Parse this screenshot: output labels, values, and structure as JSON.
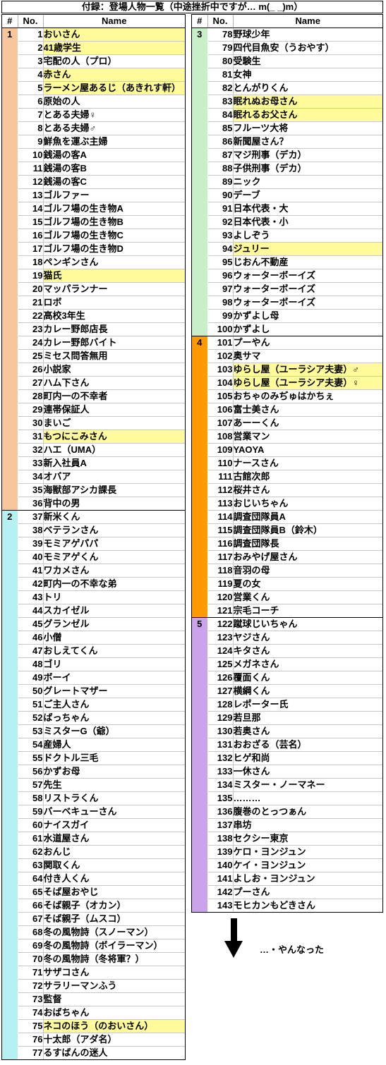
{
  "title": "付録：登場人物一覧（中途挫折中ですが… m(_ _)m）",
  "columns": {
    "group": "#",
    "no": "No.",
    "name": "Name"
  },
  "colors": {
    "group1": "#F7C79B",
    "group2": "#B5F0F2",
    "group3": "#C8F0C8",
    "group4": "#FF9900",
    "group5": "#CBA3EB",
    "highlight": "#FFFB9A",
    "grid_line": "#C8C8C8",
    "border": "#000000"
  },
  "footer": {
    "note": "…・やんなった",
    "arrow": "down-arrow"
  },
  "left_table": {
    "rows": [
      {
        "group": "1",
        "no": "1",
        "name": "おいさん",
        "hl": true
      },
      {
        "group": "",
        "no": "2",
        "name": "41歳学生",
        "hl": true
      },
      {
        "group": "",
        "no": "3",
        "name": "宅配の人（プロ）",
        "hl": false
      },
      {
        "group": "",
        "no": "4",
        "name": "赤さん",
        "hl": true
      },
      {
        "group": "",
        "no": "5",
        "name": "ラーメン屋あるじ（あきれす軒）",
        "hl": true
      },
      {
        "group": "",
        "no": "6",
        "name": "原始の人",
        "hl": false
      },
      {
        "group": "",
        "no": "7",
        "name": "とある夫婦♀",
        "hl": false
      },
      {
        "group": "",
        "no": "8",
        "name": "とある夫婦♂",
        "hl": false
      },
      {
        "group": "",
        "no": "9",
        "name": "鮮魚を運ぶ主婦",
        "hl": false
      },
      {
        "group": "",
        "no": "10",
        "name": "銭湯の客A",
        "hl": false
      },
      {
        "group": "",
        "no": "11",
        "name": "銭湯の客B",
        "hl": false
      },
      {
        "group": "",
        "no": "12",
        "name": "銭湯の客C",
        "hl": false
      },
      {
        "group": "",
        "no": "13",
        "name": "ゴルファー",
        "hl": false
      },
      {
        "group": "",
        "no": "14",
        "name": "ゴルフ場の生き物A",
        "hl": false
      },
      {
        "group": "",
        "no": "15",
        "name": "ゴルフ場の生き物B",
        "hl": false
      },
      {
        "group": "",
        "no": "16",
        "name": "ゴルフ場の生き物C",
        "hl": false
      },
      {
        "group": "",
        "no": "17",
        "name": "ゴルフ場の生き物D",
        "hl": false
      },
      {
        "group": "",
        "no": "18",
        "name": "ペンギンさん",
        "hl": false
      },
      {
        "group": "",
        "no": "19",
        "name": "猫氏",
        "hl": true
      },
      {
        "group": "",
        "no": "20",
        "name": "マッパランナー",
        "hl": false
      },
      {
        "group": "",
        "no": "21",
        "name": "ロボ",
        "hl": false
      },
      {
        "group": "",
        "no": "22",
        "name": "高校3年生",
        "hl": false
      },
      {
        "group": "",
        "no": "23",
        "name": "カレー野郎店長",
        "hl": false
      },
      {
        "group": "",
        "no": "24",
        "name": "カレー野郎バイト",
        "hl": false
      },
      {
        "group": "",
        "no": "25",
        "name": "ミセス問答無用",
        "hl": false
      },
      {
        "group": "",
        "no": "26",
        "name": "小説家",
        "hl": false
      },
      {
        "group": "",
        "no": "27",
        "name": "ハム下さん",
        "hl": false
      },
      {
        "group": "",
        "no": "28",
        "name": "町内一の不幸者",
        "hl": false
      },
      {
        "group": "",
        "no": "29",
        "name": "連帯保証人",
        "hl": false
      },
      {
        "group": "",
        "no": "30",
        "name": "まいご",
        "hl": false
      },
      {
        "group": "",
        "no": "31",
        "name": "もつにこみさん",
        "hl": true
      },
      {
        "group": "",
        "no": "32",
        "name": "ハエ（UMA）",
        "hl": false
      },
      {
        "group": "",
        "no": "33",
        "name": "新入社員A",
        "hl": false
      },
      {
        "group": "",
        "no": "34",
        "name": "オバア",
        "hl": false
      },
      {
        "group": "",
        "no": "35",
        "name": "海獣部アシカ課長",
        "hl": false
      },
      {
        "group": "",
        "no": "36",
        "name": "背中の男",
        "hl": false,
        "group_end": true
      },
      {
        "group": "2",
        "no": "37",
        "name": "新米くん",
        "hl": false
      },
      {
        "group": "",
        "no": "38",
        "name": "ベテランさん",
        "hl": false
      },
      {
        "group": "",
        "no": "39",
        "name": "モミアゲパパ",
        "hl": false
      },
      {
        "group": "",
        "no": "40",
        "name": "モミアゲくん",
        "hl": false
      },
      {
        "group": "",
        "no": "41",
        "name": "ワカメさん",
        "hl": false
      },
      {
        "group": "",
        "no": "42",
        "name": "町内一の不幸な弟",
        "hl": false
      },
      {
        "group": "",
        "no": "43",
        "name": "トリ",
        "hl": false
      },
      {
        "group": "",
        "no": "44",
        "name": "スカイゼル",
        "hl": false
      },
      {
        "group": "",
        "no": "45",
        "name": "グランゼル",
        "hl": false
      },
      {
        "group": "",
        "no": "46",
        "name": "小僧",
        "hl": false
      },
      {
        "group": "",
        "no": "47",
        "name": "おしえてくん",
        "hl": false
      },
      {
        "group": "",
        "no": "48",
        "name": "ゴリ",
        "hl": false
      },
      {
        "group": "",
        "no": "49",
        "name": "ボーイ",
        "hl": false
      },
      {
        "group": "",
        "no": "50",
        "name": "グレートマザー",
        "hl": false
      },
      {
        "group": "",
        "no": "51",
        "name": "ご主人さん",
        "hl": false
      },
      {
        "group": "",
        "no": "52",
        "name": "ばっちゃん",
        "hl": false
      },
      {
        "group": "",
        "no": "53",
        "name": "ミスターG（爺）",
        "hl": false
      },
      {
        "group": "",
        "no": "54",
        "name": "産婦人",
        "hl": false
      },
      {
        "group": "",
        "no": "55",
        "name": "ドクトル三毛",
        "hl": false
      },
      {
        "group": "",
        "no": "56",
        "name": "かずお母",
        "hl": false
      },
      {
        "group": "",
        "no": "57",
        "name": "先生",
        "hl": false
      },
      {
        "group": "",
        "no": "58",
        "name": "リストラくん",
        "hl": false
      },
      {
        "group": "",
        "no": "59",
        "name": "バーベキューさん",
        "hl": false
      },
      {
        "group": "",
        "no": "60",
        "name": "ナイスガイ",
        "hl": false
      },
      {
        "group": "",
        "no": "61",
        "name": "水道屋さん",
        "hl": false
      },
      {
        "group": "",
        "no": "62",
        "name": "おんじ",
        "hl": false
      },
      {
        "group": "",
        "no": "63",
        "name": "関取くん",
        "hl": false
      },
      {
        "group": "",
        "no": "64",
        "name": "付き人くん",
        "hl": false
      },
      {
        "group": "",
        "no": "65",
        "name": "そば屋おやじ",
        "hl": false
      },
      {
        "group": "",
        "no": "66",
        "name": "そば親子（オカン）",
        "hl": false
      },
      {
        "group": "",
        "no": "67",
        "name": "そば親子（ムスコ）",
        "hl": false
      },
      {
        "group": "",
        "no": "68",
        "name": "冬の風物詩（スノーマン）",
        "hl": false
      },
      {
        "group": "",
        "no": "69",
        "name": "冬の風物詩（ボイラーマン）",
        "hl": false
      },
      {
        "group": "",
        "no": "70",
        "name": "冬の風物詩（冬将軍？）",
        "hl": false
      },
      {
        "group": "",
        "no": "71",
        "name": "サザコさん",
        "hl": false
      },
      {
        "group": "",
        "no": "72",
        "name": "サラリーマンふう",
        "hl": false
      },
      {
        "group": "",
        "no": "73",
        "name": "監督",
        "hl": false
      },
      {
        "group": "",
        "no": "74",
        "name": "おばちゃん",
        "hl": false
      },
      {
        "group": "",
        "no": "75",
        "name": "ネコのほう（のおいさん）",
        "hl": true
      },
      {
        "group": "",
        "no": "76",
        "name": "十太郎（アダ名）",
        "hl": false
      },
      {
        "group": "",
        "no": "77",
        "name": "るすばんの迷人",
        "hl": false,
        "last": true
      }
    ]
  },
  "right_table": {
    "rows": [
      {
        "group": "3",
        "no": "78",
        "name": "野球少年",
        "hl": false
      },
      {
        "group": "",
        "no": "79",
        "name": "四代目魚安（うおやす）",
        "hl": false
      },
      {
        "group": "",
        "no": "80",
        "name": "受験生",
        "hl": false
      },
      {
        "group": "",
        "no": "81",
        "name": "女神",
        "hl": false
      },
      {
        "group": "",
        "no": "82",
        "name": "とんがりくん",
        "hl": false
      },
      {
        "group": "",
        "no": "83",
        "name": "眠れぬお母さん",
        "hl": true
      },
      {
        "group": "",
        "no": "84",
        "name": "眠れるお父さん",
        "hl": true
      },
      {
        "group": "",
        "no": "85",
        "name": "フルーツ大将",
        "hl": false
      },
      {
        "group": "",
        "no": "86",
        "name": "新聞屋さん？",
        "hl": false
      },
      {
        "group": "",
        "no": "87",
        "name": "マジ刑事（デカ）",
        "hl": false
      },
      {
        "group": "",
        "no": "88",
        "name": "子供刑事（デカ）",
        "hl": false
      },
      {
        "group": "",
        "no": "89",
        "name": "ニック",
        "hl": false
      },
      {
        "group": "",
        "no": "90",
        "name": "デーブ",
        "hl": false
      },
      {
        "group": "",
        "no": "91",
        "name": "日本代表・大",
        "hl": false
      },
      {
        "group": "",
        "no": "92",
        "name": "日本代表・小",
        "hl": false
      },
      {
        "group": "",
        "no": "93",
        "name": "よしぞう",
        "hl": false
      },
      {
        "group": "",
        "no": "94",
        "name": "ジュリー",
        "hl": true
      },
      {
        "group": "",
        "no": "95",
        "name": "じおん不動産",
        "hl": false
      },
      {
        "group": "",
        "no": "96",
        "name": "ウォーターボーイズ",
        "hl": false
      },
      {
        "group": "",
        "no": "97",
        "name": "ウォーターボーイズ",
        "hl": false
      },
      {
        "group": "",
        "no": "98",
        "name": "ウォーターボーイズ",
        "hl": false
      },
      {
        "group": "",
        "no": "99",
        "name": "かずよし母",
        "hl": false
      },
      {
        "group": "",
        "no": "100",
        "name": "かずよし",
        "hl": false,
        "group_end": true
      },
      {
        "group": "4",
        "no": "101",
        "name": "プーやん",
        "hl": false
      },
      {
        "group": "",
        "no": "102",
        "name": "奥サマ",
        "hl": false
      },
      {
        "group": "",
        "no": "103",
        "name": "ゆらし屋（ユーラシア夫妻）♂",
        "hl": true
      },
      {
        "group": "",
        "no": "104",
        "name": "ゆらし屋（ユーラシア夫妻）♀",
        "hl": true
      },
      {
        "group": "",
        "no": "105",
        "name": "おちゃのみぢゅはかちぇ",
        "hl": false
      },
      {
        "group": "",
        "no": "106",
        "name": "富士美さん",
        "hl": false
      },
      {
        "group": "",
        "no": "107",
        "name": "あーーくん",
        "hl": false
      },
      {
        "group": "",
        "no": "108",
        "name": "営業マン",
        "hl": false
      },
      {
        "group": "",
        "no": "109",
        "name": "YAOYA",
        "hl": false
      },
      {
        "group": "",
        "no": "110",
        "name": "ナースさん",
        "hl": false
      },
      {
        "group": "",
        "no": "111",
        "name": "古館次郎",
        "hl": false
      },
      {
        "group": "",
        "no": "112",
        "name": "桜井さん",
        "hl": false
      },
      {
        "group": "",
        "no": "113",
        "name": "おじいちゃん",
        "hl": false
      },
      {
        "group": "",
        "no": "114",
        "name": "調査団隊員A",
        "hl": false
      },
      {
        "group": "",
        "no": "115",
        "name": "調査団隊員B（鈴木）",
        "hl": false
      },
      {
        "group": "",
        "no": "116",
        "name": "調査団隊長",
        "hl": false
      },
      {
        "group": "",
        "no": "117",
        "name": "おみやげ屋さん",
        "hl": false
      },
      {
        "group": "",
        "no": "118",
        "name": "音羽の母",
        "hl": false
      },
      {
        "group": "",
        "no": "119",
        "name": "夏の女",
        "hl": false
      },
      {
        "group": "",
        "no": "120",
        "name": "営業くん",
        "hl": false
      },
      {
        "group": "",
        "no": "121",
        "name": "宗毛コーチ",
        "hl": false,
        "group_end": true
      },
      {
        "group": "5",
        "no": "122",
        "name": "蹴球じいちゃん",
        "hl": false
      },
      {
        "group": "",
        "no": "123",
        "name": "ヤジさん",
        "hl": false
      },
      {
        "group": "",
        "no": "124",
        "name": "キタさん",
        "hl": false
      },
      {
        "group": "",
        "no": "125",
        "name": "メガネさん",
        "hl": false
      },
      {
        "group": "",
        "no": "126",
        "name": "覆面くん",
        "hl": false
      },
      {
        "group": "",
        "no": "127",
        "name": "横綱くん",
        "hl": false
      },
      {
        "group": "",
        "no": "128",
        "name": "レポーター氏",
        "hl": false
      },
      {
        "group": "",
        "no": "129",
        "name": "若旦那",
        "hl": false
      },
      {
        "group": "",
        "no": "130",
        "name": "若奥さん",
        "hl": false
      },
      {
        "group": "",
        "no": "131",
        "name": "おおざる（芸名）",
        "hl": false
      },
      {
        "group": "",
        "no": "132",
        "name": "ヒゲ和尚",
        "hl": false
      },
      {
        "group": "",
        "no": "133",
        "name": "一休さん",
        "hl": false
      },
      {
        "group": "",
        "no": "134",
        "name": "ミスター・ノーマネー",
        "hl": false
      },
      {
        "group": "",
        "no": "135",
        "name": "………",
        "hl": false
      },
      {
        "group": "",
        "no": "136",
        "name": "腹巻のとっつぁん",
        "hl": false
      },
      {
        "group": "",
        "no": "137",
        "name": "串坊",
        "hl": false
      },
      {
        "group": "",
        "no": "138",
        "name": "セクシー東京",
        "hl": false
      },
      {
        "group": "",
        "no": "139",
        "name": "ケロ・ヨンジュン",
        "hl": false
      },
      {
        "group": "",
        "no": "140",
        "name": "ケイ・ヨンジュン",
        "hl": false
      },
      {
        "group": "",
        "no": "141",
        "name": "よしお・ヨンジュン",
        "hl": false
      },
      {
        "group": "",
        "no": "142",
        "name": "プーさん",
        "hl": false
      },
      {
        "group": "",
        "no": "143",
        "name": "モヒカンもどきさん",
        "hl": false,
        "last": true
      }
    ]
  }
}
